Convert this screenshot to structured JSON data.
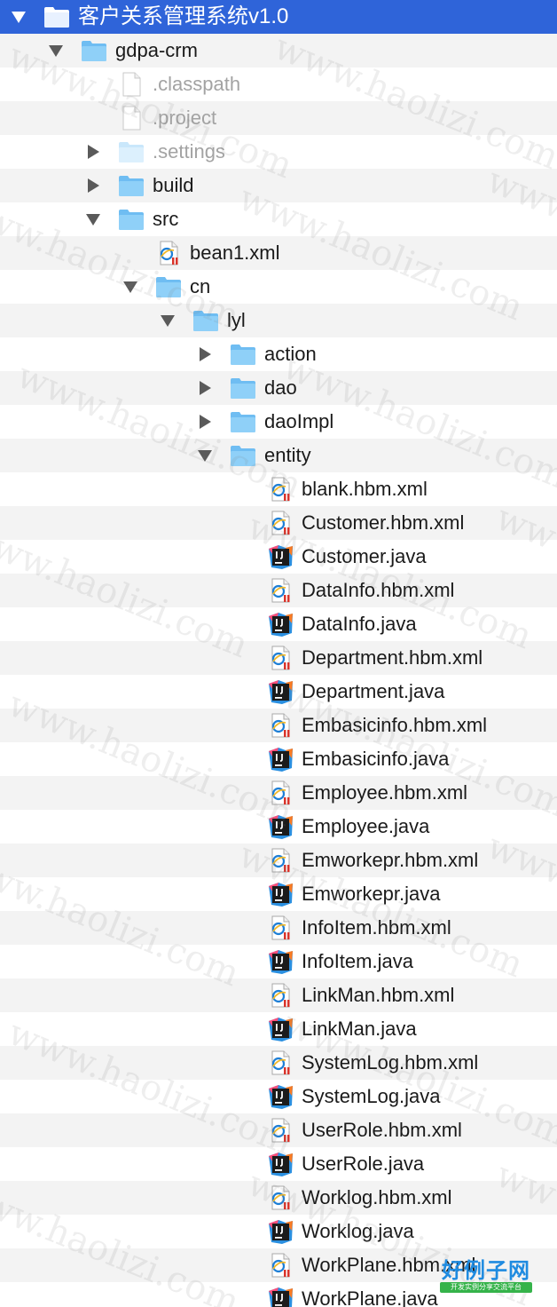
{
  "tree": [
    {
      "label": "客户关系管理系统v1.0",
      "icon": "folder-icon",
      "disclosure": "expanded",
      "level": 0,
      "selected": true
    },
    {
      "label": "gdpa-crm",
      "icon": "folder-icon",
      "disclosure": "expanded",
      "level": 1
    },
    {
      "label": ".classpath",
      "icon": "file-icon",
      "disclosure": "none",
      "level": 2,
      "dim": true
    },
    {
      "label": ".project",
      "icon": "file-icon",
      "disclosure": "none",
      "level": 2,
      "dim": true
    },
    {
      "label": ".settings",
      "icon": "folder-icon",
      "disclosure": "collapsed",
      "level": 2,
      "dim": true
    },
    {
      "label": "build",
      "icon": "folder-icon",
      "disclosure": "collapsed",
      "level": 2
    },
    {
      "label": "src",
      "icon": "folder-icon",
      "disclosure": "expanded",
      "level": 2
    },
    {
      "label": "bean1.xml",
      "icon": "xml-file-icon",
      "disclosure": "none",
      "level": 3
    },
    {
      "label": "cn",
      "icon": "folder-icon",
      "disclosure": "expanded",
      "level": 3
    },
    {
      "label": "lyl",
      "icon": "folder-icon",
      "disclosure": "expanded",
      "level": 4
    },
    {
      "label": "action",
      "icon": "folder-icon",
      "disclosure": "collapsed",
      "level": 5
    },
    {
      "label": "dao",
      "icon": "folder-icon",
      "disclosure": "collapsed",
      "level": 5
    },
    {
      "label": "daoImpl",
      "icon": "folder-icon",
      "disclosure": "collapsed",
      "level": 5
    },
    {
      "label": "entity",
      "icon": "folder-icon",
      "disclosure": "expanded",
      "level": 5
    },
    {
      "label": "blank.hbm.xml",
      "icon": "xml-file-icon",
      "disclosure": "none",
      "level": 6
    },
    {
      "label": "Customer.hbm.xml",
      "icon": "xml-file-icon",
      "disclosure": "none",
      "level": 6
    },
    {
      "label": "Customer.java",
      "icon": "java-file-icon",
      "disclosure": "none",
      "level": 6
    },
    {
      "label": "DataInfo.hbm.xml",
      "icon": "xml-file-icon",
      "disclosure": "none",
      "level": 6
    },
    {
      "label": "DataInfo.java",
      "icon": "java-file-icon",
      "disclosure": "none",
      "level": 6
    },
    {
      "label": "Department.hbm.xml",
      "icon": "xml-file-icon",
      "disclosure": "none",
      "level": 6
    },
    {
      "label": "Department.java",
      "icon": "java-file-icon",
      "disclosure": "none",
      "level": 6
    },
    {
      "label": "Embasicinfo.hbm.xml",
      "icon": "xml-file-icon",
      "disclosure": "none",
      "level": 6
    },
    {
      "label": "Embasicinfo.java",
      "icon": "java-file-icon",
      "disclosure": "none",
      "level": 6
    },
    {
      "label": "Employee.hbm.xml",
      "icon": "xml-file-icon",
      "disclosure": "none",
      "level": 6
    },
    {
      "label": "Employee.java",
      "icon": "java-file-icon",
      "disclosure": "none",
      "level": 6
    },
    {
      "label": "Emworkepr.hbm.xml",
      "icon": "xml-file-icon",
      "disclosure": "none",
      "level": 6
    },
    {
      "label": "Emworkepr.java",
      "icon": "java-file-icon",
      "disclosure": "none",
      "level": 6
    },
    {
      "label": "InfoItem.hbm.xml",
      "icon": "xml-file-icon",
      "disclosure": "none",
      "level": 6
    },
    {
      "label": "InfoItem.java",
      "icon": "java-file-icon",
      "disclosure": "none",
      "level": 6
    },
    {
      "label": "LinkMan.hbm.xml",
      "icon": "xml-file-icon",
      "disclosure": "none",
      "level": 6
    },
    {
      "label": "LinkMan.java",
      "icon": "java-file-icon",
      "disclosure": "none",
      "level": 6
    },
    {
      "label": "SystemLog.hbm.xml",
      "icon": "xml-file-icon",
      "disclosure": "none",
      "level": 6
    },
    {
      "label": "SystemLog.java",
      "icon": "java-file-icon",
      "disclosure": "none",
      "level": 6
    },
    {
      "label": "UserRole.hbm.xml",
      "icon": "xml-file-icon",
      "disclosure": "none",
      "level": 6
    },
    {
      "label": "UserRole.java",
      "icon": "java-file-icon",
      "disclosure": "none",
      "level": 6
    },
    {
      "label": "Worklog.hbm.xml",
      "icon": "xml-file-icon",
      "disclosure": "none",
      "level": 6
    },
    {
      "label": "Worklog.java",
      "icon": "java-file-icon",
      "disclosure": "none",
      "level": 6
    },
    {
      "label": "WorkPlane.hbm.xml",
      "icon": "xml-file-icon",
      "disclosure": "none",
      "level": 6
    },
    {
      "label": "WorkPlane.java",
      "icon": "java-file-icon",
      "disclosure": "none",
      "level": 6
    }
  ],
  "watermark": {
    "text": "www.haolizi.com"
  },
  "logo": {
    "main": "好例子网",
    "sub": "开发实例分享交流平台"
  },
  "colors": {
    "selection": "#2f64d9",
    "folder": "#7cc4f4",
    "java_badge": "#1b1b1b",
    "xml_badge": "#d9342b"
  }
}
